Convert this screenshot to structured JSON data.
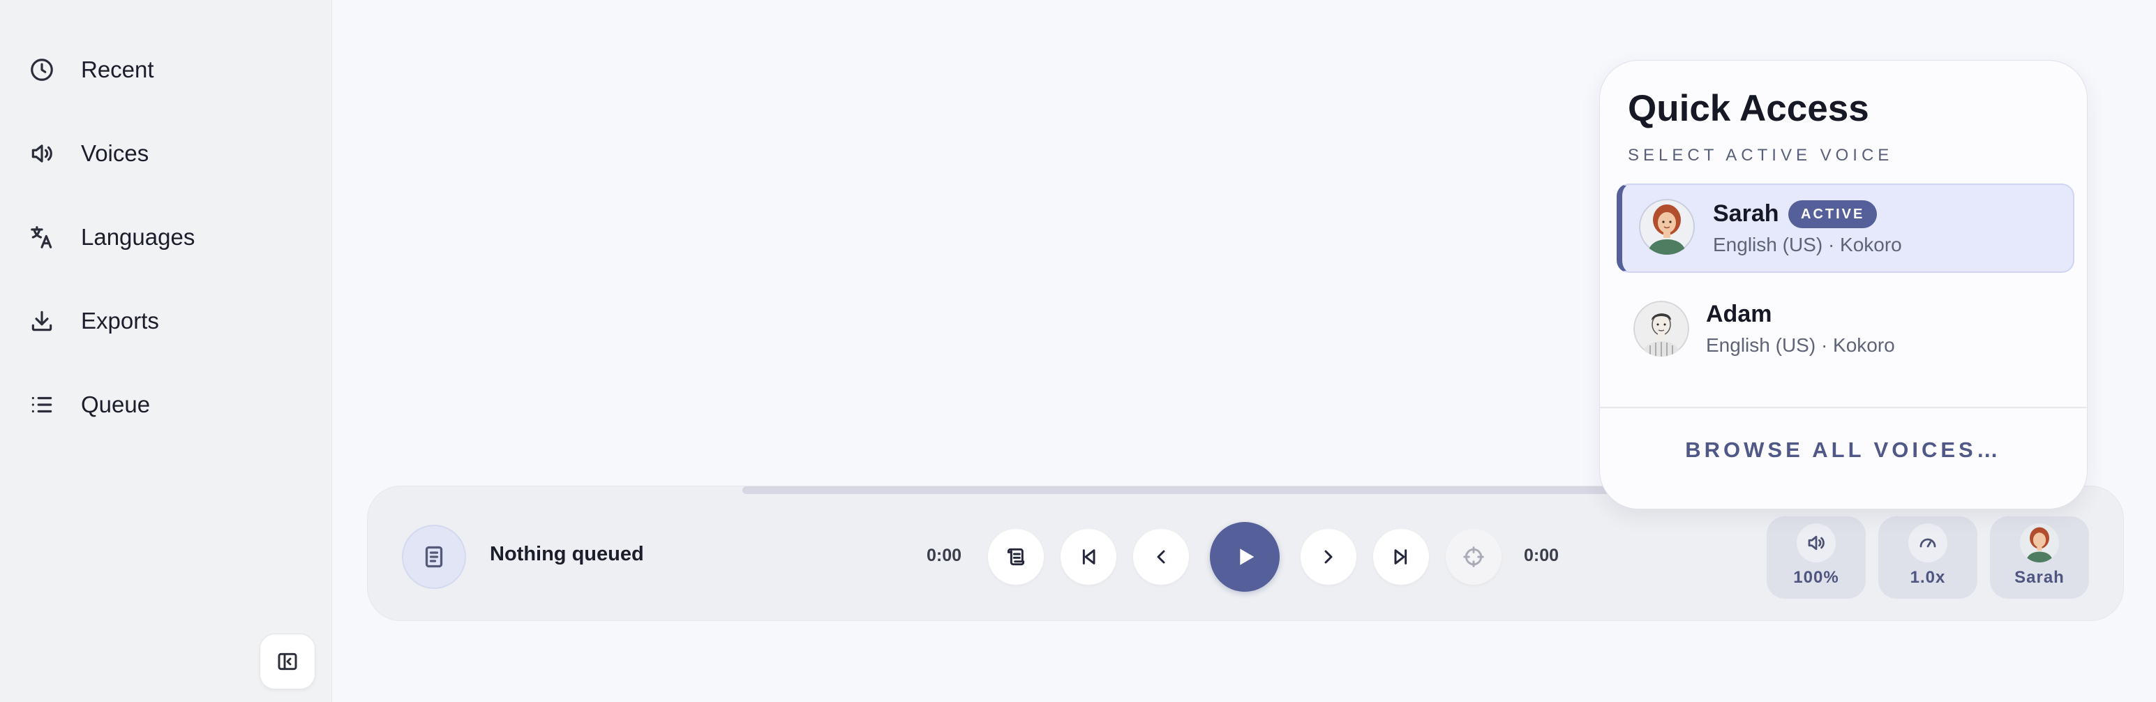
{
  "sidebar": {
    "items": [
      {
        "label": "Recent",
        "icon": "clock-icon"
      },
      {
        "label": "Voices",
        "icon": "speaker-icon"
      },
      {
        "label": "Languages",
        "icon": "translate-icon"
      },
      {
        "label": "Exports",
        "icon": "download-icon"
      },
      {
        "label": "Queue",
        "icon": "list-icon"
      }
    ],
    "collapse_icon": "sidebar-collapse-icon"
  },
  "player": {
    "now_playing": "Nothing queued",
    "time_elapsed": "0:00",
    "time_total": "0:00",
    "progress": 0,
    "volume_label": "100%",
    "speed_label": "1.0x",
    "voice_label": "Sarah"
  },
  "quick_access": {
    "title": "Quick Access",
    "subtitle": "SELECT ACTIVE VOICE",
    "voices": [
      {
        "name": "Sarah",
        "meta": "English (US) · Kokoro",
        "active": true,
        "badge": "ACTIVE"
      },
      {
        "name": "Adam",
        "meta": "English (US) · Kokoro",
        "active": false
      }
    ],
    "browse_label": "BROWSE ALL VOICES…"
  },
  "colors": {
    "accent": "#555f99",
    "active_row_bg": "#e6e9fb",
    "sidebar_bg": "#f1f2f4",
    "page_bg": "#f7f8fc"
  }
}
